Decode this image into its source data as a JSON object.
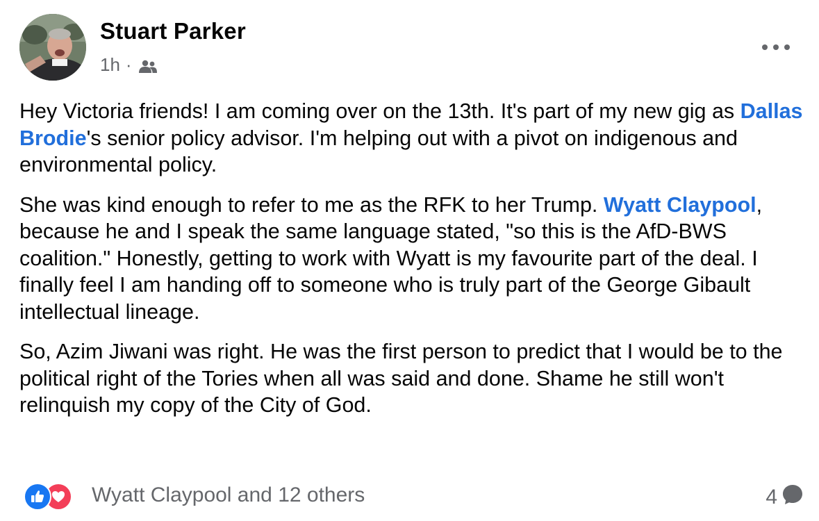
{
  "post": {
    "author": "Stuart Parker",
    "time": "1h",
    "separator": "·",
    "audience_icon": "friends-icon",
    "more_icon": "more-horizontal-icon",
    "body": {
      "p1": {
        "before": "Hey Victoria friends! I am coming over on the 13th. It's part of my new gig as ",
        "mention": "Dallas Brodie",
        "after": "'s senior policy advisor. I'm helping out with a pivot on indigenous and environmental policy."
      },
      "p2": {
        "before": "She was kind enough to refer to me as the RFK to her Trump. ",
        "mention": "Wyatt Claypool",
        "after": ", because he and I speak the same language stated, \"so this is the AfD-BWS coalition.\" Honestly, getting to work with Wyatt is my favourite part of the deal. I finally feel I am handing off to someone who is truly part of the George Gibault intellectual lineage."
      },
      "p3": "So, Azim Jiwani was right. He was the first person to predict that I would be to the political right of the Tories when all was said and done. Shame he still won't relinquish my copy of the City of God."
    }
  },
  "reactions": {
    "icons": [
      "like-icon",
      "love-icon"
    ],
    "summary": "Wyatt Claypool and 12 others",
    "comment_count": "4",
    "comment_icon": "comment-bubble-icon"
  },
  "colors": {
    "text": "#050505",
    "secondary": "#65676b",
    "link": "#216fdb",
    "like": "#1877f2",
    "love": "#f33e58"
  }
}
